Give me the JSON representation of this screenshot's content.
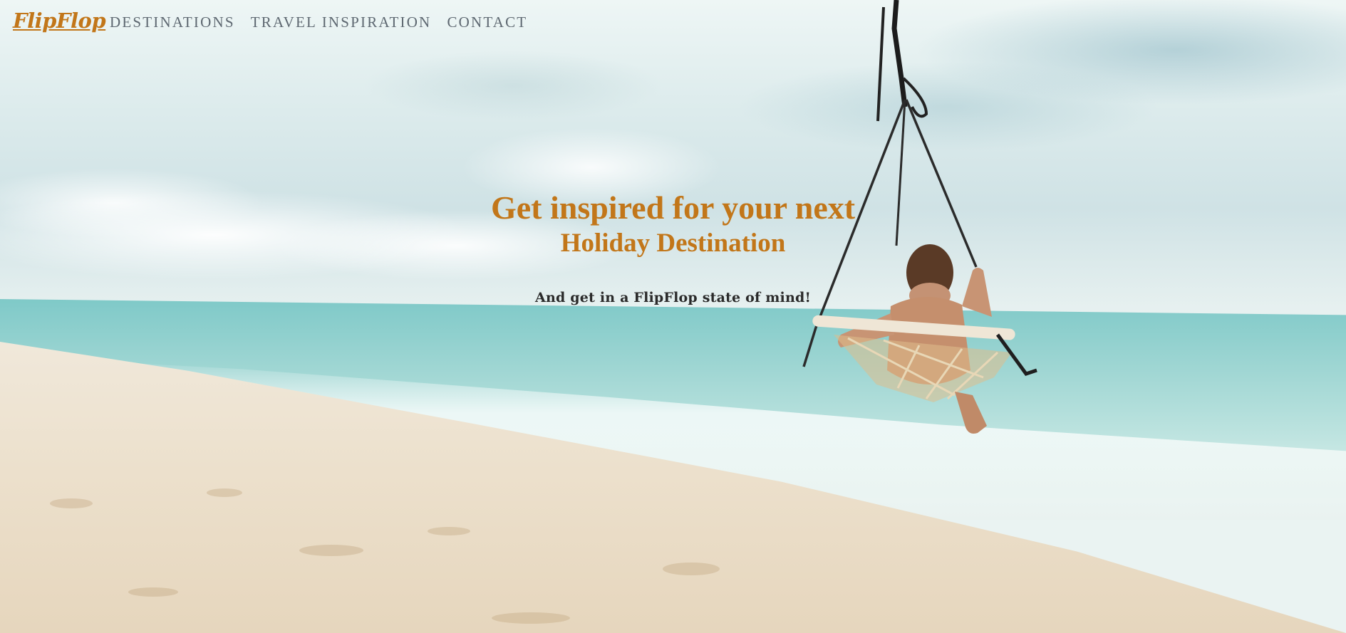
{
  "brand": {
    "logo": "FlipFlop",
    "accent_color": "#c27619"
  },
  "nav": {
    "items": [
      {
        "label": "DESTINATIONS"
      },
      {
        "label": "TRAVEL INSPIRATION"
      },
      {
        "label": "CONTACT"
      }
    ]
  },
  "hero": {
    "title": "Get inspired for your next",
    "subtitle": "Holiday Destination",
    "tagline": "And get in a FlipFlop state of mind!",
    "title_color": "#c27619",
    "tagline_color": "#2a2a2a"
  },
  "background": {
    "image_icon": "beach-swing-photo-icon"
  }
}
